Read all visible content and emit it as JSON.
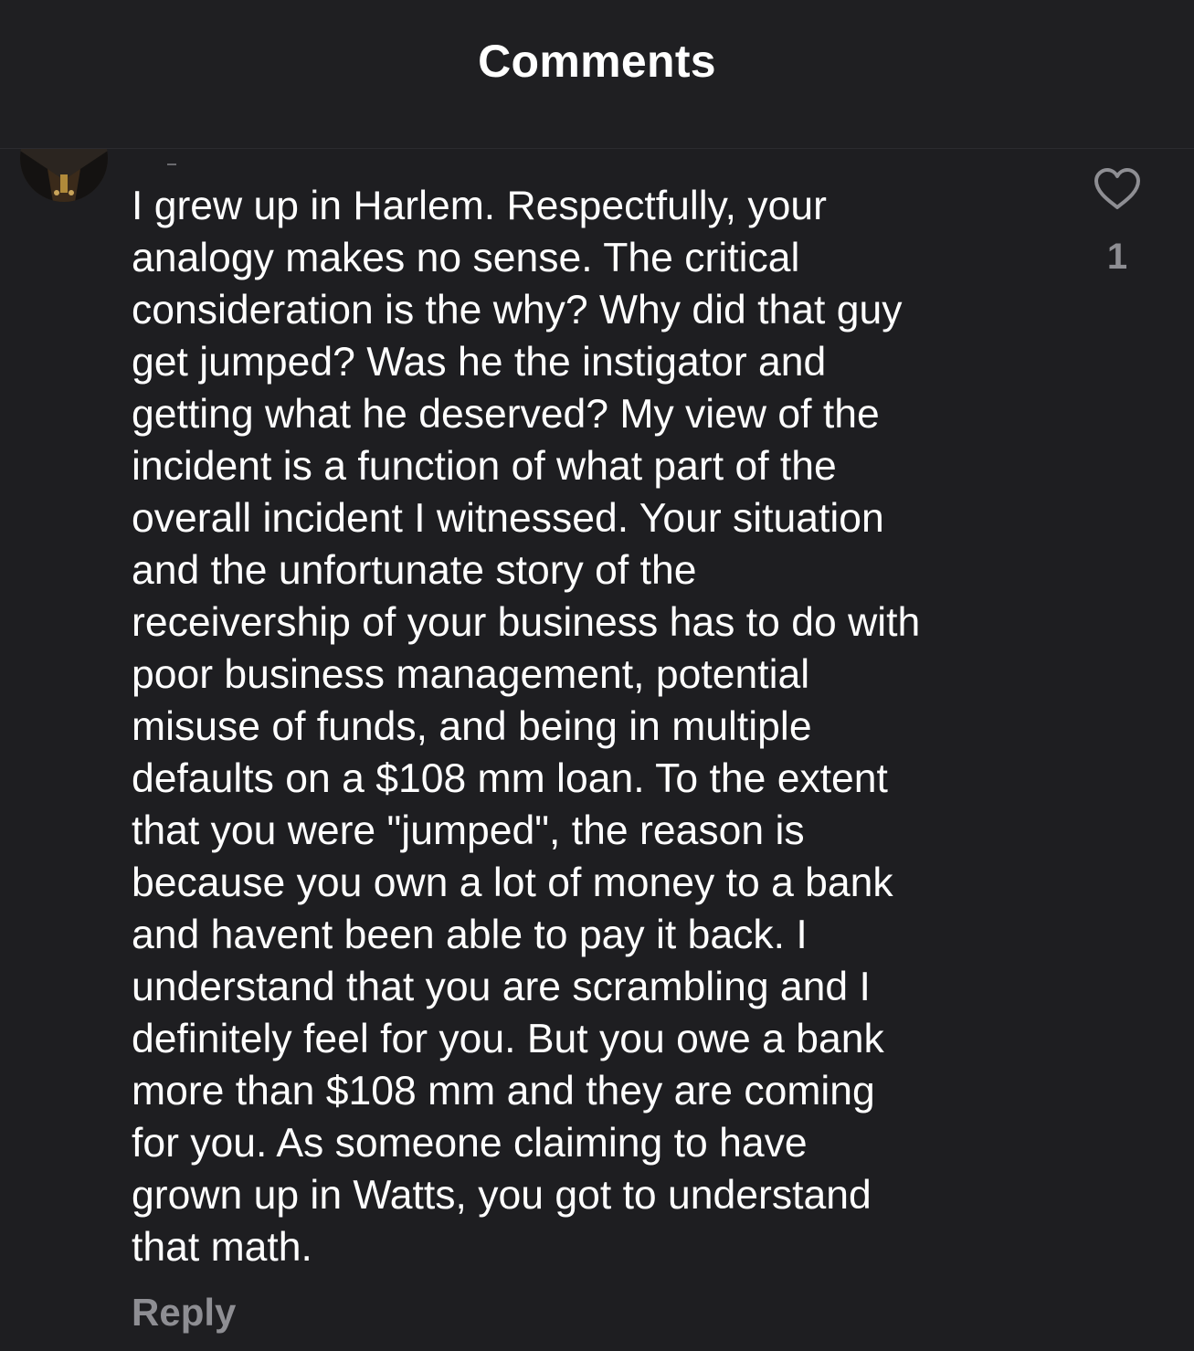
{
  "header": {
    "title": "Comments"
  },
  "comment": {
    "avatar_icon": "user-avatar",
    "text": "I grew up in Harlem. Respectfully, your\nanalogy makes no sense. The critical\nconsideration is the why? Why did that guy\nget jumped? Was he the instigator and\ngetting what he deserved? My view of the\nincident is a function of what part of the\noverall incident I witnessed. Your situation\nand the unfortunate story of the\nreceivership of your business has to do with\npoor business management, potential\nmisuse of funds, and being in multiple\ndefaults on a $108 mm loan. To the extent\nthat you were \"jumped\", the reason is\nbecause you own a lot of money to a bank\nand havent been able to pay it back. I\nunderstand that you are scrambling and I\ndefinitely feel for you. But you owe a bank\nmore than $108 mm and they are coming\nfor you. As someone claiming to have\ngrown up in Watts, you got to understand\nthat math.",
    "reply_label": "Reply",
    "like_icon": "heart-outline-icon",
    "like_count": "1"
  },
  "colors": {
    "background": "#1e1e21",
    "text": "#ffffff",
    "muted": "#8e8e93"
  }
}
